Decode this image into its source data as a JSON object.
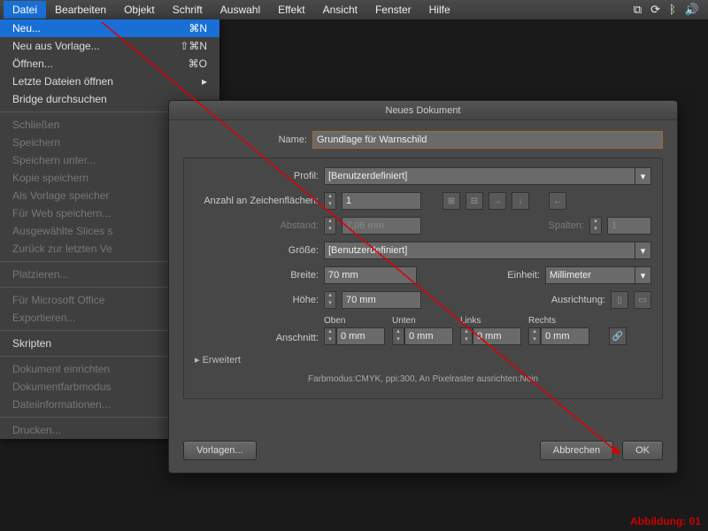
{
  "menubar": {
    "items": [
      "Datei",
      "Bearbeiten",
      "Objekt",
      "Schrift",
      "Auswahl",
      "Effekt",
      "Ansicht",
      "Fenster",
      "Hilfe"
    ]
  },
  "filemenu": {
    "neu": {
      "label": "Neu...",
      "shortcut": "⌘N"
    },
    "neu_vorlage": {
      "label": "Neu aus Vorlage...",
      "shortcut": "⇧⌘N"
    },
    "oeffnen": {
      "label": "Öffnen...",
      "shortcut": "⌘O"
    },
    "letzte": {
      "label": "Letzte Dateien öffnen"
    },
    "bridge": {
      "label": "Bridge durchsuchen"
    },
    "schliessen": {
      "label": "Schließen"
    },
    "speichern": {
      "label": "Speichern"
    },
    "speichern_unter": {
      "label": "Speichern unter..."
    },
    "kopie": {
      "label": "Kopie speichern"
    },
    "vorlage_speichern": {
      "label": "Als Vorlage speicher"
    },
    "web": {
      "label": "Für Web speichern..."
    },
    "slices": {
      "label": "Ausgewählte Slices s"
    },
    "zurueck": {
      "label": "Zurück zur letzten Ve"
    },
    "platzieren": {
      "label": "Platzieren..."
    },
    "office": {
      "label": "Für Microsoft Office"
    },
    "export": {
      "label": "Exportieren..."
    },
    "skripten": {
      "label": "Skripten"
    },
    "einrichten": {
      "label": "Dokument einrichten"
    },
    "farbmodus": {
      "label": "Dokumentfarbmodus"
    },
    "dateiinfo": {
      "label": "Dateiinformationen..."
    },
    "drucken": {
      "label": "Drucken..."
    }
  },
  "dialog": {
    "title": "Neues Dokument",
    "name_label": "Name:",
    "name_value": "Grundlage für Warnschild",
    "profil_label": "Profil:",
    "profil_value": "[Benutzerdefiniert]",
    "artboards_label": "Anzahl an Zeichenflächen:",
    "artboards_value": "1",
    "abstand_label": "Abstand:",
    "abstand_value": "7,06 mm",
    "spalten_label": "Spalten:",
    "spalten_value": "1",
    "groesse_label": "Größe:",
    "groesse_value": "[Benutzerdefiniert]",
    "breite_label": "Breite:",
    "breite_value": "70 mm",
    "einheit_label": "Einheit:",
    "einheit_value": "Millimeter",
    "hoehe_label": "Höhe:",
    "hoehe_value": "70 mm",
    "ausrichtung_label": "Ausrichtung:",
    "anschnitt_label": "Anschnitt:",
    "bleed": {
      "oben": "Oben",
      "unten": "Unten",
      "links": "Links",
      "rechts": "Rechts",
      "val": "0 mm"
    },
    "erweitert": "Erweitert",
    "summary": "Farbmodus:CMYK, ppi:300, An Pixelraster ausrichten:Nein",
    "vorlagen": "Vorlagen...",
    "abbrechen": "Abbrechen",
    "ok": "OK"
  },
  "caption": "Abbildung: 01"
}
